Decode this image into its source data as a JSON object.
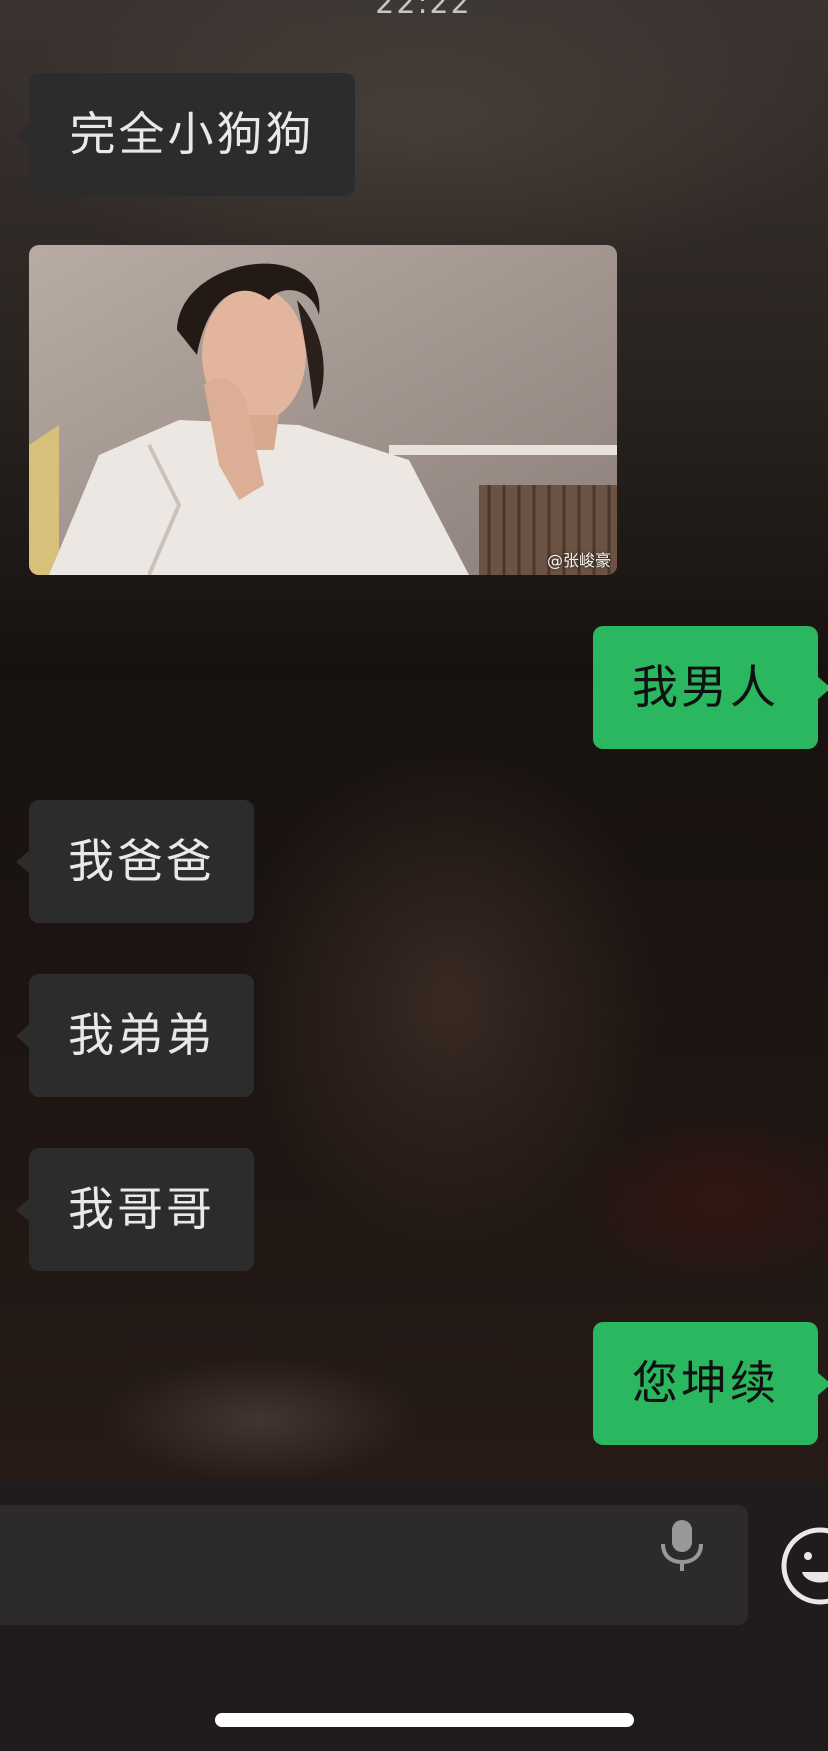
{
  "header": {
    "time": "22:22"
  },
  "messages": [
    {
      "side": "left",
      "type": "text",
      "text": "完全小狗狗"
    },
    {
      "side": "left",
      "type": "image",
      "watermark": "@张峻豪"
    },
    {
      "side": "right",
      "type": "text",
      "text": "我男人"
    },
    {
      "side": "left",
      "type": "text",
      "text": "我爸爸"
    },
    {
      "side": "left",
      "type": "text",
      "text": "我弟弟"
    },
    {
      "side": "left",
      "type": "text",
      "text": "我哥哥"
    },
    {
      "side": "right",
      "type": "text",
      "text": "您坤续"
    }
  ],
  "input_bar": {
    "value": "",
    "mic_icon": "microphone-icon",
    "emoji_icon": "emoji-icon"
  },
  "colors": {
    "sent_bubble": "#2bb660",
    "received_bubble": "#2c2c2c"
  }
}
